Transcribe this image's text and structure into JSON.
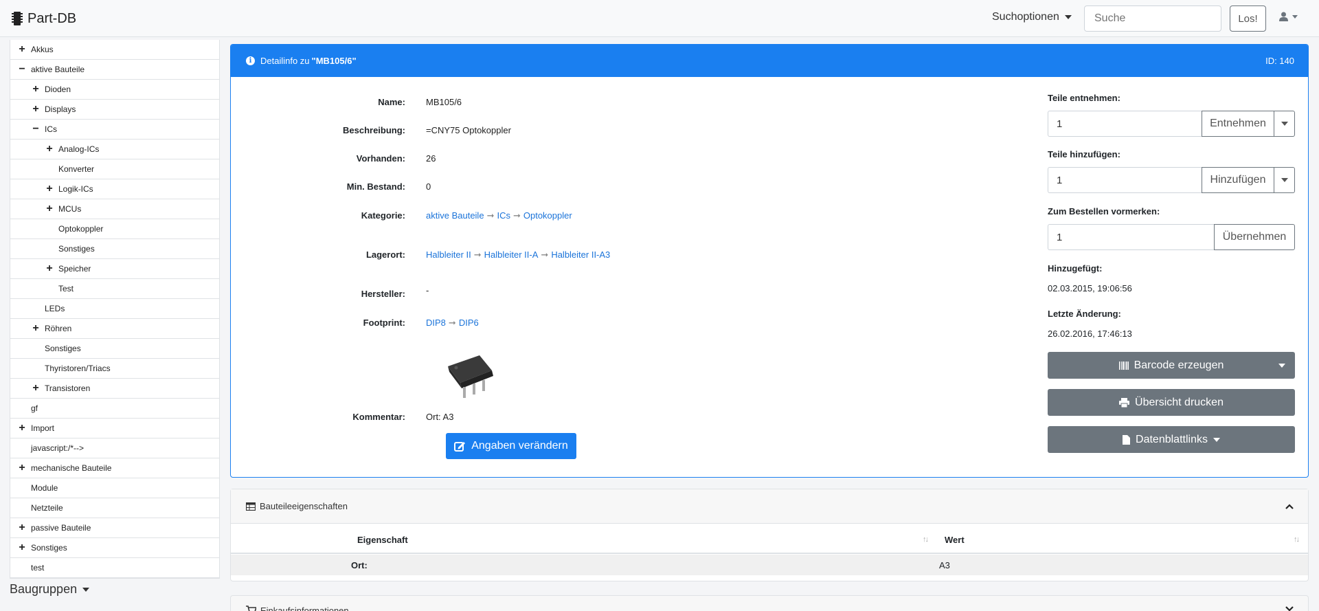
{
  "app": {
    "title": "Part-DB"
  },
  "navbar": {
    "search_options": "Suchoptionen",
    "search_placeholder": "Suche",
    "go_label": "Los!"
  },
  "sidebar": {
    "items": [
      {
        "label": "Akkus",
        "level": 0,
        "toggle": "+"
      },
      {
        "label": "aktive Bauteile",
        "level": 0,
        "toggle": "−"
      },
      {
        "label": "Dioden",
        "level": 1,
        "toggle": "+"
      },
      {
        "label": "Displays",
        "level": 1,
        "toggle": "+"
      },
      {
        "label": "ICs",
        "level": 1,
        "toggle": "−"
      },
      {
        "label": "Analog-ICs",
        "level": 2,
        "toggle": "+"
      },
      {
        "label": "Konverter",
        "level": 2,
        "toggle": ""
      },
      {
        "label": "Logik-ICs",
        "level": 2,
        "toggle": "+"
      },
      {
        "label": "MCUs",
        "level": 2,
        "toggle": "+"
      },
      {
        "label": "Optokoppler",
        "level": 2,
        "toggle": ""
      },
      {
        "label": "Sonstiges",
        "level": 2,
        "toggle": ""
      },
      {
        "label": "Speicher",
        "level": 2,
        "toggle": "+"
      },
      {
        "label": "Test",
        "level": 2,
        "toggle": ""
      },
      {
        "label": "LEDs",
        "level": 1,
        "toggle": ""
      },
      {
        "label": "Röhren",
        "level": 1,
        "toggle": "+"
      },
      {
        "label": "Sonstiges",
        "level": 1,
        "toggle": ""
      },
      {
        "label": "Thyristoren/Triacs",
        "level": 1,
        "toggle": ""
      },
      {
        "label": "Transistoren",
        "level": 1,
        "toggle": "+"
      },
      {
        "label": "gf",
        "level": 0,
        "toggle": ""
      },
      {
        "label": "Import",
        "level": 0,
        "toggle": "+"
      },
      {
        "label": "javascript:/*-->",
        "level": 0,
        "toggle": ""
      },
      {
        "label": "mechanische Bauteile",
        "level": 0,
        "toggle": "+"
      },
      {
        "label": "Module",
        "level": 0,
        "toggle": ""
      },
      {
        "label": "Netzteile",
        "level": 0,
        "toggle": ""
      },
      {
        "label": "passive Bauteile",
        "level": 0,
        "toggle": "+"
      },
      {
        "label": "Sonstiges",
        "level": 0,
        "toggle": "+"
      },
      {
        "label": "test",
        "level": 0,
        "toggle": ""
      }
    ],
    "group_heading": "Baugruppen"
  },
  "detail": {
    "header_prefix": "Detailinfo zu ",
    "header_name": "\"MB105/6\"",
    "id_label": "ID: 140",
    "labels": {
      "name": "Name:",
      "description": "Beschreibung:",
      "instock": "Vorhanden:",
      "mininstock": "Min. Bestand:",
      "category": "Kategorie:",
      "storelocation": "Lagerort:",
      "manufacturer": "Hersteller:",
      "footprint": "Footprint:",
      "comment": "Kommentar:"
    },
    "values": {
      "name": "MB105/6",
      "description": "=CNY75 Optokoppler",
      "instock": "26",
      "mininstock": "0",
      "category": [
        "aktive Bauteile",
        "ICs",
        "Optokoppler"
      ],
      "storelocation": [
        "Halbleiter II",
        "Halbleiter II-A",
        "Halbleiter II-A3"
      ],
      "manufacturer": "-",
      "footprint": [
        "DIP8",
        "DIP6"
      ],
      "comment": "Ort: A3"
    },
    "arrow": "➞",
    "edit_button": "Angaben verändern"
  },
  "actions": {
    "withdraw_label": "Teile entnehmen:",
    "withdraw_value": "1",
    "withdraw_button": "Entnehmen",
    "add_label": "Teile hinzufügen:",
    "add_value": "1",
    "add_button": "Hinzufügen",
    "order_label": "Zum Bestellen vormerken:",
    "order_value": "1",
    "order_button": "Übernehmen",
    "added_label": "Hinzugefügt:",
    "added_value": "02.03.2015, 19:06:56",
    "modified_label": "Letzte Änderung:",
    "modified_value": "26.02.2016, 17:46:13",
    "barcode_button": "Barcode erzeugen",
    "print_button": "Übersicht drucken",
    "datasheet_button": "Datenblattlinks"
  },
  "properties": {
    "title": "Bauteileeigenschaften",
    "columns": [
      "Eigenschaft",
      "Wert"
    ],
    "rows": [
      {
        "property": "Ort:",
        "value": "A3"
      }
    ]
  },
  "purchase": {
    "title": "Einkaufsinformationen"
  },
  "colors": {
    "primary": "#1a7ff0",
    "secondary": "#6c757d",
    "link": "#1a73d9"
  }
}
